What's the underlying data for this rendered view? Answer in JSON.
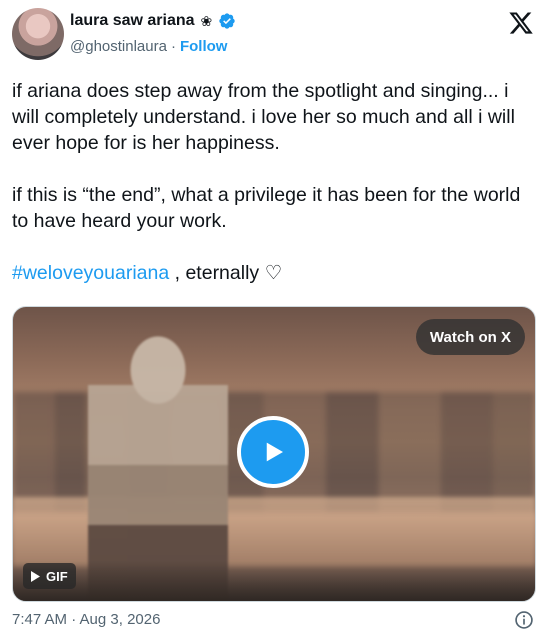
{
  "author": {
    "display_name": "laura saw ariana",
    "name_emoji": "❀",
    "handle": "@ghostinlaura",
    "separator": "·",
    "follow_label": "Follow"
  },
  "tweet": {
    "paragraph_1": "if ariana does step away from the spotlight and singing... i will completely understand. i love her so much and all i will ever hope for is her happiness.",
    "paragraph_2": "if this is “the end”, what a privilege it has been for the world to have heard your work.",
    "hashtag": "#weloveyouariana",
    "paragraph_3_rest": " , eternally ♡"
  },
  "media": {
    "watch_label": "Watch on X",
    "badge_label": "GIF"
  },
  "footer": {
    "timestamp": "7:47 AM · Aug 3, 2026"
  },
  "colors": {
    "accent": "#1d9bf0",
    "text": "#0f1419",
    "muted": "#536471"
  },
  "icons": {
    "brand": "x-logo-icon",
    "verified": "verified-badge-icon",
    "play": "play-icon",
    "info": "info-icon"
  }
}
